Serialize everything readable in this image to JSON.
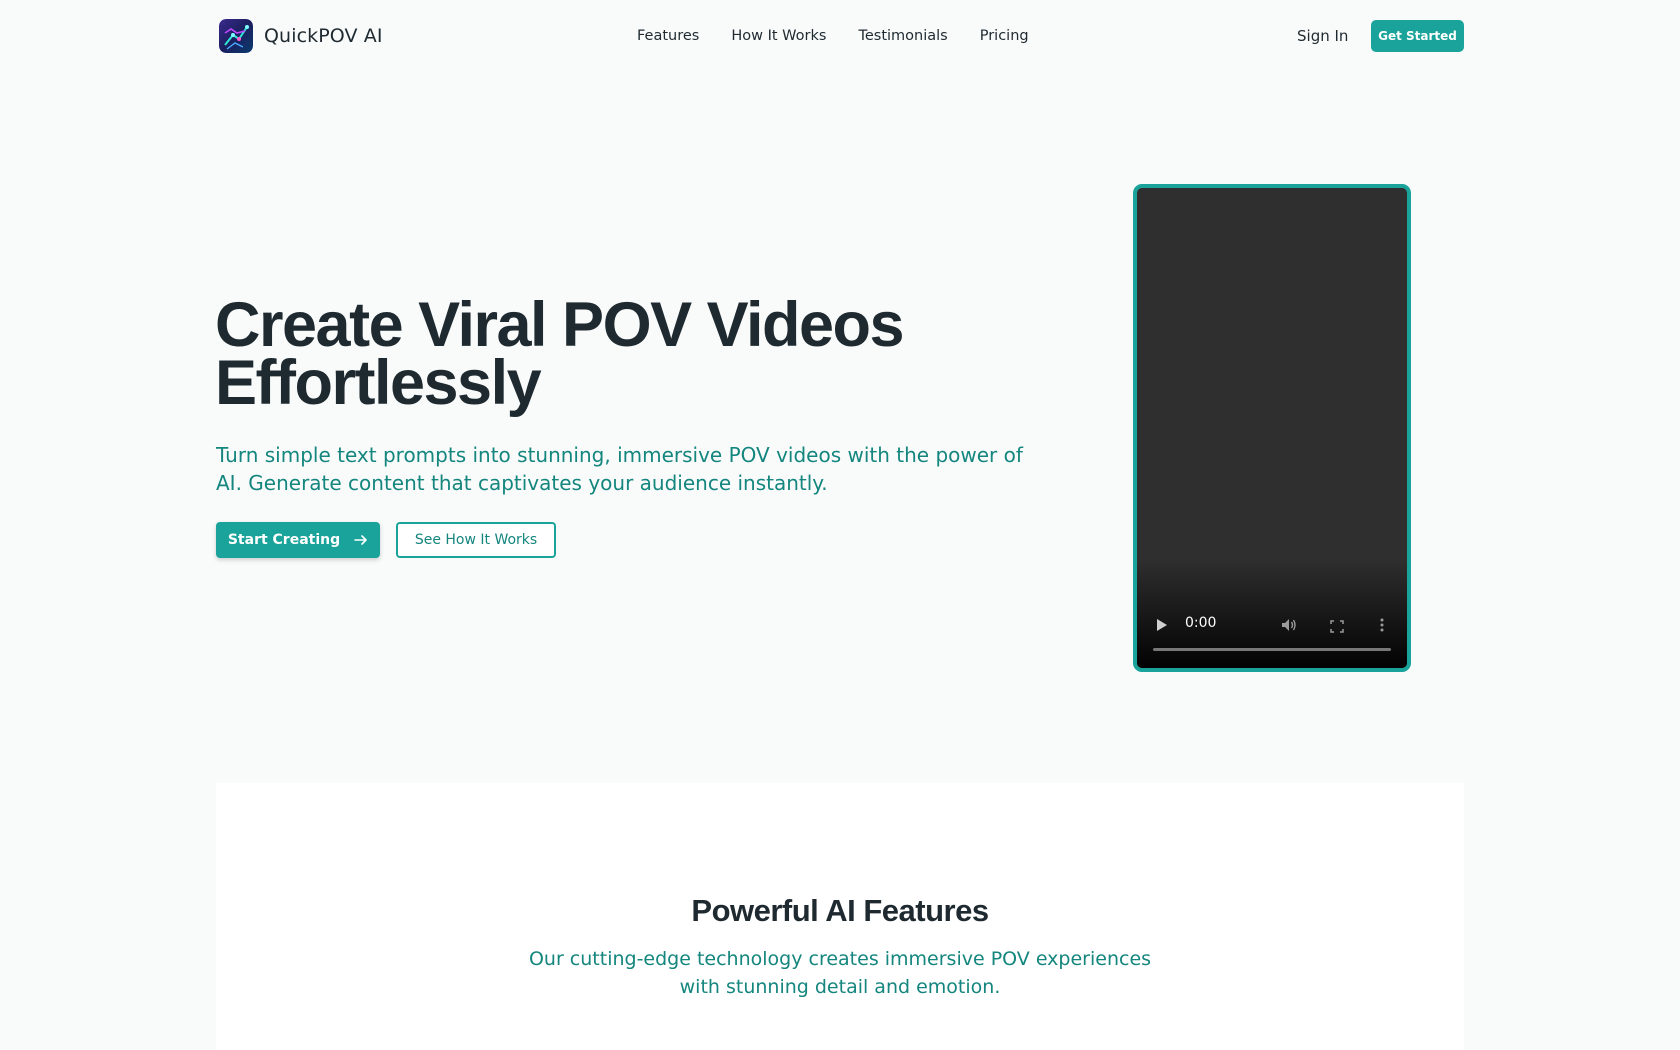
{
  "brand": {
    "name": "QuickPOV AI",
    "logo_icon": "ai-brain-logo-icon"
  },
  "nav": {
    "items": [
      "Features",
      "How It Works",
      "Testimonials",
      "Pricing"
    ]
  },
  "auth": {
    "sign_in": "Sign In",
    "get_started": "Get Started"
  },
  "hero": {
    "title_line1": "Create Viral POV Videos",
    "title_line2": "Effortlessly",
    "subtitle": "Turn simple text prompts into stunning, immersive POV videos with the power of AI. Generate content that captivates your audience instantly.",
    "primary_cta": "Start Creating",
    "primary_cta_icon": "arrow-right-icon",
    "secondary_cta": "See How It Works"
  },
  "video": {
    "time": "0:00",
    "progress": 0
  },
  "features": {
    "title": "Powerful AI Features",
    "subtitle": "Our cutting-edge technology creates immersive POV experiences with stunning detail and emotion."
  },
  "colors": {
    "accent": "#1aa39a",
    "accent_text": "#14867e",
    "heading": "#1f2a30",
    "background": "#f9fbfb"
  }
}
